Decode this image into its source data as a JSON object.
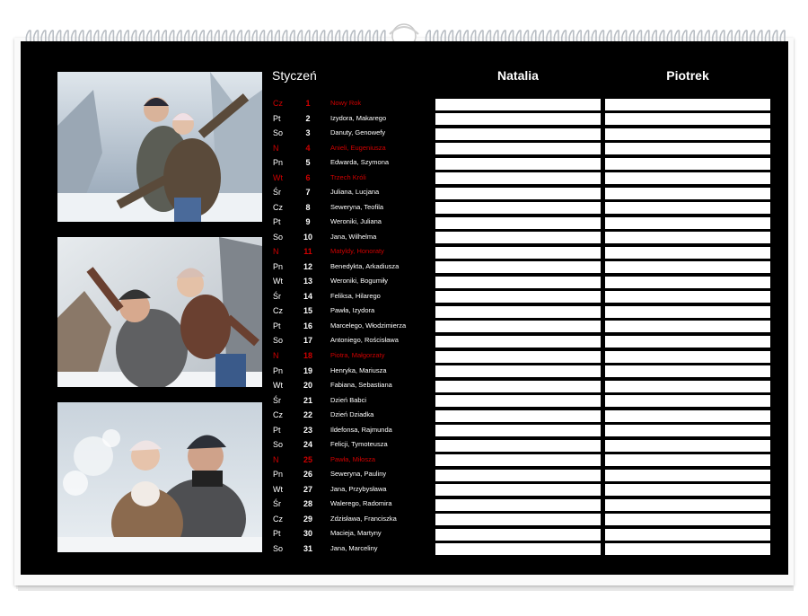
{
  "calendar": {
    "month": "Styczeń",
    "columns": [
      "Natalia",
      "Piotrek"
    ],
    "colors": {
      "background": "#000000",
      "text": "#ffffff",
      "holiday": "#d00000",
      "cell": "#ffffff"
    },
    "photos": [
      "couple-piggyback-snow",
      "couple-playing-snow",
      "couple-blowing-snow"
    ],
    "days": [
      {
        "wd": "Cz",
        "d": "1",
        "name": "Nowy Rok",
        "holiday": true
      },
      {
        "wd": "Pt",
        "d": "2",
        "name": "Izydora, Makarego",
        "holiday": false
      },
      {
        "wd": "So",
        "d": "3",
        "name": "Danuty, Genowefy",
        "holiday": false
      },
      {
        "wd": "N",
        "d": "4",
        "name": "Anieli, Eugeniusza",
        "holiday": true
      },
      {
        "wd": "Pn",
        "d": "5",
        "name": "Edwarda, Szymona",
        "holiday": false
      },
      {
        "wd": "Wt",
        "d": "6",
        "name": "Trzech Króli",
        "holiday": true
      },
      {
        "wd": "Śr",
        "d": "7",
        "name": "Juliana, Lucjana",
        "holiday": false
      },
      {
        "wd": "Cz",
        "d": "8",
        "name": "Seweryna, Teofila",
        "holiday": false
      },
      {
        "wd": "Pt",
        "d": "9",
        "name": "Weroniki, Juliana",
        "holiday": false
      },
      {
        "wd": "So",
        "d": "10",
        "name": "Jana, Wilhelma",
        "holiday": false
      },
      {
        "wd": "N",
        "d": "11",
        "name": "Matyldy, Honoraty",
        "holiday": true
      },
      {
        "wd": "Pn",
        "d": "12",
        "name": "Benedykta, Arkadiusza",
        "holiday": false
      },
      {
        "wd": "Wt",
        "d": "13",
        "name": "Weroniki, Bogumiły",
        "holiday": false
      },
      {
        "wd": "Śr",
        "d": "14",
        "name": "Feliksa, Hilarego",
        "holiday": false
      },
      {
        "wd": "Cz",
        "d": "15",
        "name": "Pawła, Izydora",
        "holiday": false
      },
      {
        "wd": "Pt",
        "d": "16",
        "name": "Marcelego, Włodzimierza",
        "holiday": false
      },
      {
        "wd": "So",
        "d": "17",
        "name": "Antoniego, Rościsława",
        "holiday": false
      },
      {
        "wd": "N",
        "d": "18",
        "name": "Piotra, Małgorzaty",
        "holiday": true
      },
      {
        "wd": "Pn",
        "d": "19",
        "name": "Henryka, Mariusza",
        "holiday": false
      },
      {
        "wd": "Wt",
        "d": "20",
        "name": "Fabiana, Sebastiana",
        "holiday": false
      },
      {
        "wd": "Śr",
        "d": "21",
        "name": "Dzień Babci",
        "holiday": false
      },
      {
        "wd": "Cz",
        "d": "22",
        "name": "Dzień Dziadka",
        "holiday": false
      },
      {
        "wd": "Pt",
        "d": "23",
        "name": "Ildefonsa, Rajmunda",
        "holiday": false
      },
      {
        "wd": "So",
        "d": "24",
        "name": "Felicji, Tymoteusza",
        "holiday": false
      },
      {
        "wd": "N",
        "d": "25",
        "name": "Pawła, Miłosza",
        "holiday": true
      },
      {
        "wd": "Pn",
        "d": "26",
        "name": "Seweryna, Pauliny",
        "holiday": false
      },
      {
        "wd": "Wt",
        "d": "27",
        "name": "Jana, Przybysława",
        "holiday": false
      },
      {
        "wd": "Śr",
        "d": "28",
        "name": "Walerego, Radomira",
        "holiday": false
      },
      {
        "wd": "Cz",
        "d": "29",
        "name": "Zdzisława, Franciszka",
        "holiday": false
      },
      {
        "wd": "Pt",
        "d": "30",
        "name": "Macieja, Martyny",
        "holiday": false
      },
      {
        "wd": "So",
        "d": "31",
        "name": "Jana, Marceliny",
        "holiday": false
      }
    ]
  }
}
